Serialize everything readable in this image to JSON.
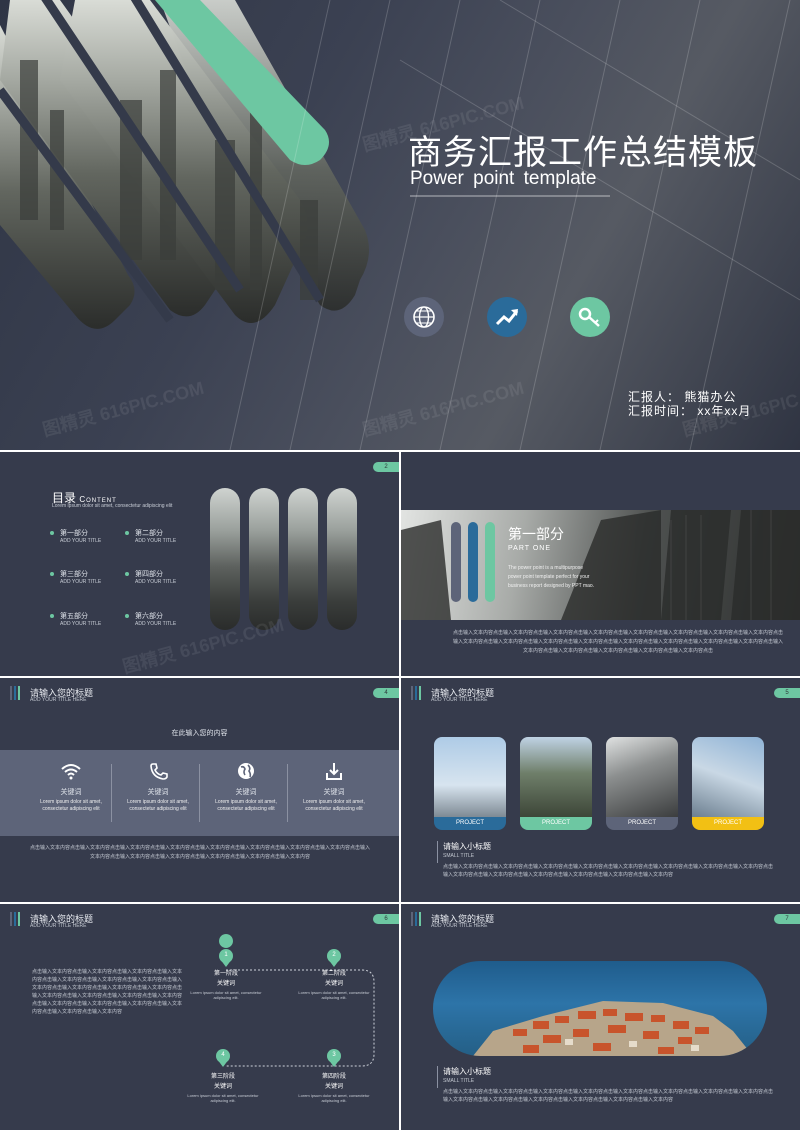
{
  "colors": {
    "bg": "#363b4c",
    "green": "#6dc7a2",
    "blue": "#2a6b9a",
    "slate": "#5d6479",
    "yellow": "#f2c014"
  },
  "cover": {
    "title": "商务汇报工作总结模板",
    "subtitle": "Power point template",
    "reporter": "汇报人： 熊猫办公",
    "time": "汇报时间： xx年xx月",
    "icons": [
      "globe-icon",
      "trend-up-icon",
      "key-icon"
    ]
  },
  "watermark": "图精灵 616PIC.COM",
  "toc": {
    "page": "2",
    "title": "目录",
    "title_en": "Content",
    "desc": "Lorem ipsum dolor sit amet, consectetur adipiscing elit",
    "items": [
      {
        "cn": "第一部分",
        "en": "ADD YOUR TITLE"
      },
      {
        "cn": "第二部分",
        "en": "ADD YOUR TITLE"
      },
      {
        "cn": "第三部分",
        "en": "ADD YOUR TITLE"
      },
      {
        "cn": "第四部分",
        "en": "ADD YOUR TITLE"
      },
      {
        "cn": "第五部分",
        "en": "ADD YOUR TITLE"
      },
      {
        "cn": "第六部分",
        "en": "ADD YOUR TITLE"
      }
    ]
  },
  "part1": {
    "title": "第一部分",
    "sub": "PART ONE",
    "desc": "The power point is a multipurpose power point template perfect for your business report designed by PPT mao.",
    "body": "点击输入文本内容点击输入文本内容点击输入文本内容点击输入文本内容点击输入文本内容点击输入文本内容点击输入文本内容点击输入文本内容点击输入文本内容点击输入文本内容点击输入文本内容点击输入文本内容点击输入文本内容点击输入文本内容点击输入文本内容点击输入文本内容点击输入文本内容点击输入文本内容点击输入文本内容点击输入文本内容点击输入文本内容点击"
  },
  "slide4": {
    "page": "4",
    "title": "请输入您的标题",
    "sub": "ADD YOUR TITLE HERE",
    "center": "在此输入您的内容",
    "keys": [
      {
        "label": "关键词",
        "text": "Lorem ipsum dolor sit amet, consectetur adipiscing elit"
      },
      {
        "label": "关键词",
        "text": "Lorem ipsum dolor sit amet, consectetur adipiscing elit"
      },
      {
        "label": "关键词",
        "text": "Lorem ipsum dolor sit amet, consectetur adipiscing elit"
      },
      {
        "label": "关键词",
        "text": "Lorem ipsum dolor sit amet, consectetur adipiscing elit"
      }
    ],
    "body": "点击输入文本内容点击输入文本内容点击输入文本内容点击输入文本内容点击输入文本内容点击输入文本内容点击输入文本内容点击输入文本内容点击输入文本内容点击输入文本内容点击输入文本内容点击输入文本内容点击输入文本内容点击输入文本内容"
  },
  "slide5": {
    "page": "5",
    "title": "请输入您的标题",
    "sub": "ADD YOUR TITLE HERE",
    "projects": [
      "PROJECT",
      "PROJECT",
      "PROJECT",
      "PROJECT"
    ],
    "small_title": "请输入小标题",
    "small_sub": "SMALL TITLE",
    "body": "点击输入文本内容点击输入文本内容点击输入文本内容点击输入文本内容点击输入文本内容点击输入文本内容点击输入文本内容点击输入文本内容点击输入文本内容点击输入文本内容点击输入文本内容点击输入文本内容点击输入文本内容点击输入文本内容"
  },
  "slide6": {
    "page": "6",
    "title": "请输入您的标题",
    "sub": "ADD YOUR TITLE HERE",
    "body": "点击输入文本内容点击输入文本内容点击输入文本内容点击输入文本内容点击输入文本内容点击输入文本内容点击输入文本内容点击输入文本内容点击输入文本内容点击输入文本内容点击输入文本内容点击输入文本内容点击输入文本内容点击输入文本内容点击输入文本内容点击输入文本内容点击输入文本内容点击输入文本内容点击输入文本内容点击输入文本内容点击输入文本内容",
    "steps": [
      {
        "num": "1",
        "stage": "第一阶段",
        "key": "关键词",
        "text": "Lorem ipsum dolor sit amet, consectetur adipiscing elit."
      },
      {
        "num": "2",
        "stage": "第二阶段",
        "key": "关键词",
        "text": "Lorem ipsum dolor sit amet, consectetur adipiscing elit."
      },
      {
        "num": "4",
        "stage": "第三阶段",
        "key": "关键词",
        "text": "Lorem ipsum dolor sit amet, consectetur adipiscing elit."
      },
      {
        "num": "3",
        "stage": "第四阶段",
        "key": "关键词",
        "text": "Lorem ipsum dolor sit amet, consectetur adipiscing elit."
      }
    ]
  },
  "slide7": {
    "page": "7",
    "title": "请输入您的标题",
    "sub": "ADD YOUR TITLE HERE",
    "small_title": "请输入小标题",
    "small_sub": "SMALL TITLE",
    "body": "点击输入文本内容点击输入文本内容点击输入文本内容点击输入文本内容点击输入文本内容点击输入文本内容点击输入文本内容点击输入文本内容点击输入文本内容点击输入文本内容点击输入文本内容点击输入文本内容点击输入文本内容点击输入文本内容"
  }
}
